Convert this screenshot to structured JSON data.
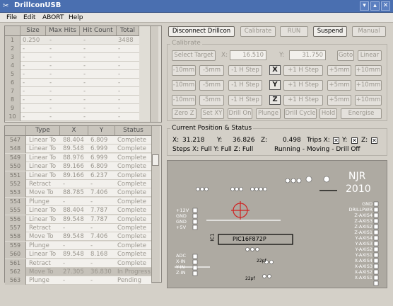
{
  "window": {
    "title": "DrillconUSB",
    "controls": [
      "▾",
      "▴",
      "✕"
    ]
  },
  "menu": [
    "File",
    "Edit",
    "ABORT",
    "Help"
  ],
  "toolbar": {
    "disconnect": "Disconnect Drillcon",
    "calibrate": "Calibrate",
    "run": "RUN",
    "suspend": "Suspend",
    "manual": "Manual"
  },
  "size_table": {
    "headers": [
      "Size",
      "Max Hits",
      "Hit Count",
      "Total"
    ],
    "rows": [
      {
        "n": "1",
        "size": "0.250",
        "max": "-",
        "count": "-",
        "total": "3488"
      },
      {
        "n": "2",
        "size": "-",
        "max": "-",
        "count": "-",
        "total": "-"
      },
      {
        "n": "3",
        "size": "-",
        "max": "-",
        "count": "-",
        "total": "-"
      },
      {
        "n": "4",
        "size": "-",
        "max": "-",
        "count": "-",
        "total": "-"
      },
      {
        "n": "5",
        "size": "-",
        "max": "-",
        "count": "-",
        "total": "-"
      },
      {
        "n": "6",
        "size": "-",
        "max": "-",
        "count": "-",
        "total": "-"
      },
      {
        "n": "7",
        "size": "-",
        "max": "-",
        "count": "-",
        "total": "-"
      },
      {
        "n": "8",
        "size": "-",
        "max": "-",
        "count": "-",
        "total": "-"
      },
      {
        "n": "9",
        "size": "-",
        "max": "-",
        "count": "-",
        "total": "-"
      },
      {
        "n": "10",
        "size": "-",
        "max": "-",
        "count": "-",
        "total": "-"
      }
    ]
  },
  "move_table": {
    "headers": [
      "Type",
      "X",
      "Y",
      "Status"
    ],
    "rows": [
      {
        "n": "547",
        "type": "Linear To",
        "x": "88.404",
        "y": "6.809",
        "status": "Complete"
      },
      {
        "n": "548",
        "type": "Linear To",
        "x": "89.548",
        "y": "6.999",
        "status": "Complete"
      },
      {
        "n": "549",
        "type": "Linear To",
        "x": "88.976",
        "y": "6.999",
        "status": "Complete"
      },
      {
        "n": "550",
        "type": "Linear To",
        "x": "89.166",
        "y": "6.809",
        "status": "Complete"
      },
      {
        "n": "551",
        "type": "Linear To",
        "x": "89.166",
        "y": "6.237",
        "status": "Complete"
      },
      {
        "n": "552",
        "type": "Retract",
        "x": "-",
        "y": "-",
        "status": "Complete"
      },
      {
        "n": "553",
        "type": "Move To",
        "x": "88.785",
        "y": "7.406",
        "status": "Complete"
      },
      {
        "n": "554",
        "type": "Plunge",
        "x": "-",
        "y": "-",
        "status": "Complete"
      },
      {
        "n": "555",
        "type": "Linear To",
        "x": "88.404",
        "y": "7.787",
        "status": "Complete"
      },
      {
        "n": "556",
        "type": "Linear To",
        "x": "89.548",
        "y": "7.787",
        "status": "Complete"
      },
      {
        "n": "557",
        "type": "Retract",
        "x": "-",
        "y": "-",
        "status": "Complete"
      },
      {
        "n": "558",
        "type": "Move To",
        "x": "89.548",
        "y": "7.406",
        "status": "Complete"
      },
      {
        "n": "559",
        "type": "Plunge",
        "x": "-",
        "y": "-",
        "status": "Complete"
      },
      {
        "n": "560",
        "type": "Linear To",
        "x": "89.548",
        "y": "8.168",
        "status": "Complete"
      },
      {
        "n": "561",
        "type": "Retract",
        "x": "-",
        "y": "-",
        "status": "Complete"
      },
      {
        "n": "562",
        "type": "Move To",
        "x": "27.305",
        "y": "36.830",
        "status": "In Progress"
      },
      {
        "n": "563",
        "type": "Plunge",
        "x": "-",
        "y": "-",
        "status": "Pending"
      }
    ]
  },
  "calibrate": {
    "title": "Calibrate",
    "select_target": "Select Target",
    "x_label": "X:",
    "x_value": "16.510",
    "y_label": "Y:",
    "y_value": "31.750",
    "goto": "Goto",
    "linear": "Linear",
    "steps_neg": [
      "-10mm",
      "-5mm",
      "-1 H Step"
    ],
    "steps_pos": [
      "+1 H Step",
      "+5mm",
      "+10mm"
    ],
    "axes": [
      "X",
      "Y",
      "Z"
    ],
    "bottom": [
      "Zero Z",
      "Set XY",
      "Drill On",
      "Plunge",
      "Drill Cycle",
      "Hold",
      "Energise"
    ]
  },
  "position": {
    "title": "Current Position & Status",
    "x_label": "X:",
    "x": "31.218",
    "y_label": "Y:",
    "y": "36.826",
    "z_label": "Z:",
    "z": "0.498",
    "trips_label": "Trips X:",
    "trip_y": "Y:",
    "trip_z": "Z:",
    "steps": "Steps X: Full  Y: Full  Z: Full",
    "state": "Running - Moving - Drill Off"
  },
  "pcb": {
    "title_lines": [
      "NJR",
      "2010"
    ],
    "chip": "PIC16F872P",
    "ic": "IC1",
    "labels_right": [
      "GND",
      "DRILLPWR",
      "Z-AXIS4",
      "Z-AXIS3",
      "Z-AXIS2",
      "Z-AXIS1",
      "Y-AXIS4",
      "Y-AXIS3",
      "Y-AXIS2",
      "Y-AXIS1",
      "X-AXIS4",
      "X-AXIS3",
      "X-AXIS2",
      "X-AXIS1"
    ],
    "labels_left": [
      "+12V",
      "GND",
      "GND",
      "+5V"
    ],
    "labels_mid": [
      "ADC",
      "X-IN",
      "Y-IN",
      "Z-IN"
    ],
    "caps": [
      "22pf",
      "22pf"
    ],
    "colors": {
      "board": "#aeaaa2",
      "trace": "#ffffff",
      "target": "#d02020"
    }
  }
}
